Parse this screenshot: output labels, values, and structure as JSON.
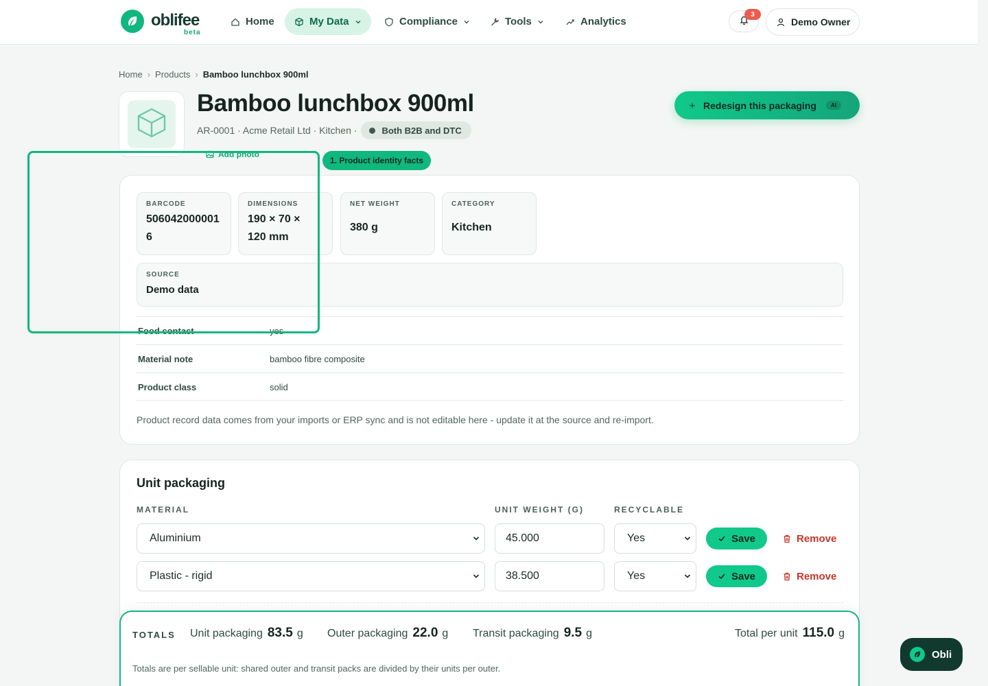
{
  "brand": {
    "name": "oblifee",
    "tag": "beta"
  },
  "nav": {
    "home": "Home",
    "my_data": "My Data",
    "compliance": "Compliance",
    "tools": "Tools",
    "analytics": "Analytics",
    "notifications_count": "3",
    "user": "Demo Owner"
  },
  "breadcrumb": [
    "Home",
    "Products",
    "Bamboo lunchbox 900ml"
  ],
  "product": {
    "title": "Bamboo lunchbox 900ml",
    "meta": "AR-0001 · Acme Retail Ltd · Kitchen ·",
    "channel": "Both B2B and DTC",
    "add_photo": "Add photo",
    "redesign": "Redesign this packaging",
    "ai_badge": "AI"
  },
  "tour": {
    "label": "1. Product identity facts"
  },
  "facts": [
    {
      "label": "BARCODE",
      "value": "5060420000016"
    },
    {
      "label": "DIMENSIONS",
      "value": "190 × 70 × 120 mm"
    },
    {
      "label": "NET WEIGHT",
      "value": "380 g"
    },
    {
      "label": "CATEGORY",
      "value": "Kitchen"
    }
  ],
  "source": {
    "label": "SOURCE",
    "value": "Demo data"
  },
  "attributes": [
    {
      "key": "Food contact",
      "value": "yes"
    },
    {
      "key": "Material note",
      "value": "bamboo fibre composite"
    },
    {
      "key": "Product class",
      "value": "solid"
    }
  ],
  "record_note": "Product record data comes from your imports or ERP sync and is not editable here - update it at the source and re-import.",
  "unit_packaging": {
    "title": "Unit packaging",
    "headers": {
      "material": "MATERIAL",
      "weight": "UNIT WEIGHT (G)",
      "recyclable": "RECYCLABLE"
    },
    "rows": [
      {
        "material": "Aluminium",
        "weight": "45.000",
        "recyclable": "Yes"
      },
      {
        "material": "Plastic - rigid",
        "weight": "38.500",
        "recyclable": "Yes"
      }
    ],
    "save_label": "Save",
    "remove_label": "Remove"
  },
  "totals": {
    "label": "TOTALS",
    "unit_label": "Unit packaging",
    "unit_value": "83.5",
    "unit_unit": "g",
    "outer_label": "Outer packaging",
    "outer_value": "22.0",
    "outer_unit": "g",
    "transit_label": "Transit packaging",
    "transit_value": "9.5",
    "transit_unit": "g",
    "total_label": "Total per unit",
    "total_value": "115.0",
    "total_unit": "g",
    "note": "Totals are per sellable unit: shared outer and transit packs are divided by their units per outer."
  },
  "assistant": {
    "label": "Obli"
  },
  "colors": {
    "accent": "#10b77f",
    "danger": "#c8352b",
    "dark": "#12392d"
  }
}
